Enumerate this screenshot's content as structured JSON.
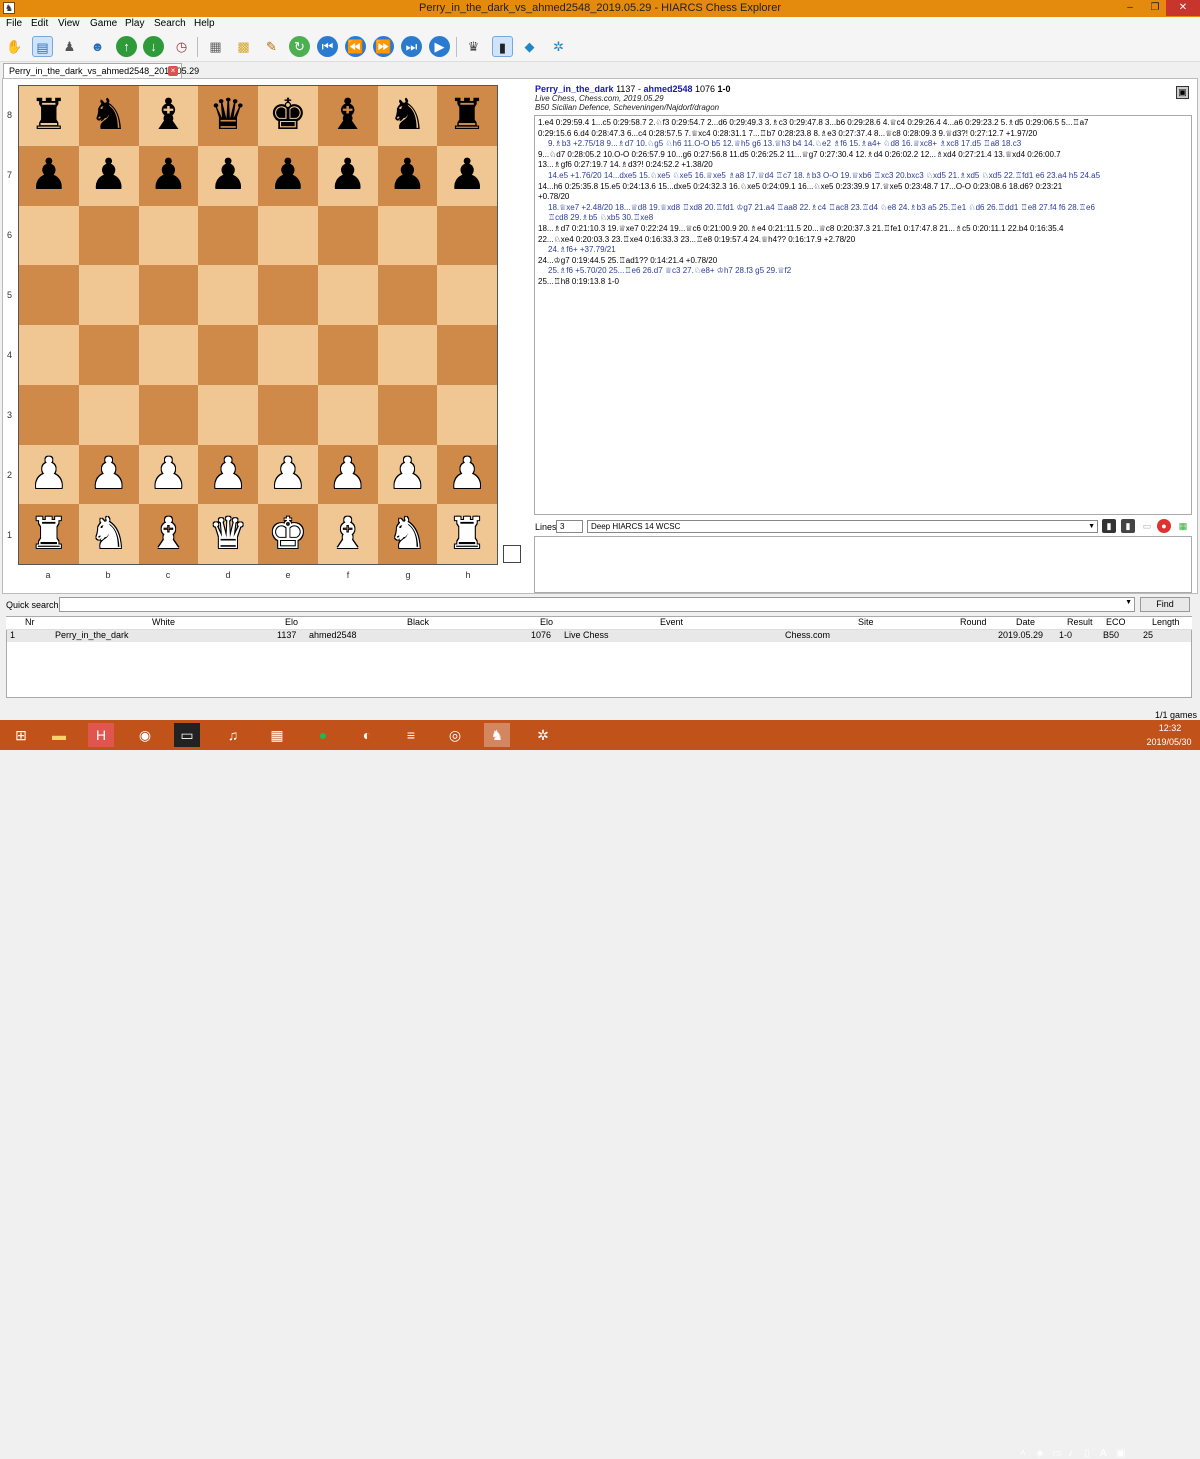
{
  "window": {
    "title": "Perry_in_the_dark_vs_ahmed2548_2019.05.29 - HIARCS Chess Explorer",
    "controls": {
      "minimize": "–",
      "maximize": "❐",
      "close": "✕"
    }
  },
  "menu": [
    "File",
    "Edit",
    "View",
    "Game",
    "Play",
    "Search",
    "Help"
  ],
  "tab": {
    "label": "Perry_in_the_dark_vs_ahmed2548_2019.05.29",
    "close": "×"
  },
  "board": {
    "rows": [
      [
        "♜",
        "♞",
        "♝",
        "♛",
        "♚",
        "♝",
        "♞",
        "♜"
      ],
      [
        "♟",
        "♟",
        "♟",
        "♟",
        "♟",
        "♟",
        "♟",
        "♟"
      ],
      [
        "",
        "",
        "",
        "",
        "",
        "",
        "",
        ""
      ],
      [
        "",
        "",
        "",
        "",
        "",
        "",
        "",
        ""
      ],
      [
        "",
        "",
        "",
        "",
        "",
        "",
        "",
        ""
      ],
      [
        "",
        "",
        "",
        "",
        "",
        "",
        "",
        ""
      ],
      [
        "♟",
        "♟",
        "♟",
        "♟",
        "♟",
        "♟",
        "♟",
        "♟"
      ],
      [
        "♜",
        "♞",
        "♝",
        "♛",
        "♚",
        "♝",
        "♞",
        "♜"
      ]
    ],
    "colors": [
      [
        "b",
        "b",
        "b",
        "b",
        "b",
        "b",
        "b",
        "b"
      ],
      [
        "b",
        "b",
        "b",
        "b",
        "b",
        "b",
        "b",
        "b"
      ],
      [
        "",
        "",
        "",
        "",
        "",
        "",
        "",
        ""
      ],
      [
        "",
        "",
        "",
        "",
        "",
        "",
        "",
        ""
      ],
      [
        "",
        "",
        "",
        "",
        "",
        "",
        "",
        ""
      ],
      [
        "",
        "",
        "",
        "",
        "",
        "",
        "",
        ""
      ],
      [
        "w",
        "w",
        "w",
        "w",
        "w",
        "w",
        "w",
        "w"
      ],
      [
        "w",
        "w",
        "w",
        "w",
        "w",
        "w",
        "w",
        "w"
      ]
    ],
    "ranks": [
      "8",
      "7",
      "6",
      "5",
      "4",
      "3",
      "2",
      "1"
    ],
    "files": [
      "a",
      "b",
      "c",
      "d",
      "e",
      "f",
      "g",
      "h"
    ],
    "light_color": "#f0c692",
    "dark_color": "#cf8a4a"
  },
  "game": {
    "white": "Perry_in_the_dark",
    "white_elo": "1137",
    "black": "ahmed2548",
    "black_elo": "1076",
    "result": "1-0",
    "event_line": "Live Chess, Chess.com, 2019.05.29",
    "opening": "B50 Sicilian Defence, Scheveningen/Najdorf/dragon"
  },
  "notation": [
    {
      "t": "m",
      "s": "1.e4 0:29:59.4 1...c5 0:29:58.7 2.♘f3 0:29:54.7 2...d6 0:29:49.3 3.♗c3 0:29:47.8 3...b6 0:29:28.6 4.♕c4 0:29:26.4 4...a6 0:29:23.2 5.♗d5 0:29:06.5 5...♖a7"
    },
    {
      "t": "m",
      "s": "0:29:15.6 6.d4 0:28:47.3 6...c4 0:28:57.5 7.♕xc4 0:28:31.1 7...♖b7 0:28:23.8 8.♗e3 0:27:37.4 8...♕c8 0:28:09.3 9.♕d3?! 0:27:12.7 +1.97/20"
    },
    {
      "t": "v",
      "s": "9.♗b3 +2.75/18 9...♗d7 10.♘g5 ♘h6 11.O-O b5 12.♕h5 g6 13.♕h3 b4 14.♘e2 ♗f6 15.♗a4+ ♘d8 16.♕xc8+ ♗xc8 17.d5 ♖a8 18.c3"
    },
    {
      "t": "m",
      "s": "9...♘d7 0:28:05.2 10.O-O 0:26:57.9 10...g6 0:27:56.8 11.d5 0:26:25.2 11...♕g7 0:27:30.4 12.♗d4 0:26:02.2 12...♗xd4 0:27:21.4 13.♕xd4 0:26:00.7"
    },
    {
      "t": "m",
      "s": "13...♗gf6 0:27:19.7 14.♗d3?! 0:24:52.2 +1.38/20"
    },
    {
      "t": "v",
      "s": "14.e5 +1.76/20 14...dxe5 15.♘xe5 ♘xe5 16.♕xe5 ♗a8 17.♕d4 ♖c7 18.♗b3 O-O 19.♕xb6 ♖xc3 20.bxc3 ♘xd5 21.♗xd5 ♘xd5 22.♖fd1 e6 23.a4 h5 24.a5"
    },
    {
      "t": "m",
      "s": "14...h6 0:25:35.8 15.e5 0:24:13.6 15...dxe5 0:24:32.3 16.♘xe5 0:24:09.1 16...♘xe5 0:23:39.9 17.♕xe5 0:23:48.7 17...O-O 0:23:08.6 18.d6? 0:23:21"
    },
    {
      "t": "m",
      "s": "+0.78/20"
    },
    {
      "t": "v",
      "s": "18.♕xe7 +2.48/20 18...♕d8 19.♕xd8 ♖xd8 20.♖fd1 ♔g7 21.a4 ♖aa8 22.♗c4 ♖ac8 23.♖d4 ♘e8 24.♗b3 a5 25.♖e1 ♘d6 26.♖dd1 ♖e8 27.f4 f6 28.♖e6"
    },
    {
      "t": "v",
      "s": "♖cd8 29.♗b5 ♘xb5 30.♖xe8"
    },
    {
      "t": "m",
      "s": "18...♗d7 0:21:10.3 19.♕xe7 0:22:24 19...♕c6 0:21:00.9 20.♗e4 0:21:11.5 20...♕c8 0:20:37.3 21.♖fe1 0:17:47.8 21...♗c5 0:20:11.1 22.b4 0:16:35.4"
    },
    {
      "t": "m",
      "s": "22...♘xe4 0:20:03.3 23.♖xe4 0:16:33.3 23...♖e8 0:19:57.4 24.♕h4?? 0:16:17.9 +2.78/20"
    },
    {
      "t": "v",
      "s": "24.♗f6+ +37.79/21"
    },
    {
      "t": "m",
      "s": "24...♔g7 0:19:44.5 25.♖ad1?? 0:14:21.4 +0.78/20"
    },
    {
      "t": "v",
      "s": "25.♗f6 +5.70/20 25...♖e6 26.d7 ♕c3 27.♘e8+ ♔h7 28.f3 g5 29.♕f2"
    },
    {
      "t": "m",
      "s": "25...♖h8 0:19:13.8 1-0"
    }
  ],
  "engine": {
    "lines_label": "Lines:",
    "lines_value": "3",
    "engine_name": "Deep HIARCS 14 WCSC"
  },
  "quick_search": {
    "label": "Quick search:",
    "value": "",
    "find_button": "Find"
  },
  "games_table": {
    "columns": [
      "Nr",
      "White",
      "Elo",
      "Black",
      "Elo",
      "Event",
      "Site",
      "Round",
      "Date",
      "Result",
      "ECO",
      "Length"
    ],
    "rows": [
      [
        "1",
        "Perry_in_the_dark",
        "1137",
        "ahmed2548",
        "1076",
        "Live Chess",
        "Chess.com",
        "",
        "2019.05.29",
        "1-0",
        "B50",
        "25"
      ]
    ]
  },
  "status": {
    "count": "1/1 games"
  },
  "taskbar": {
    "time": "12:32",
    "date": "2019/05/30"
  }
}
